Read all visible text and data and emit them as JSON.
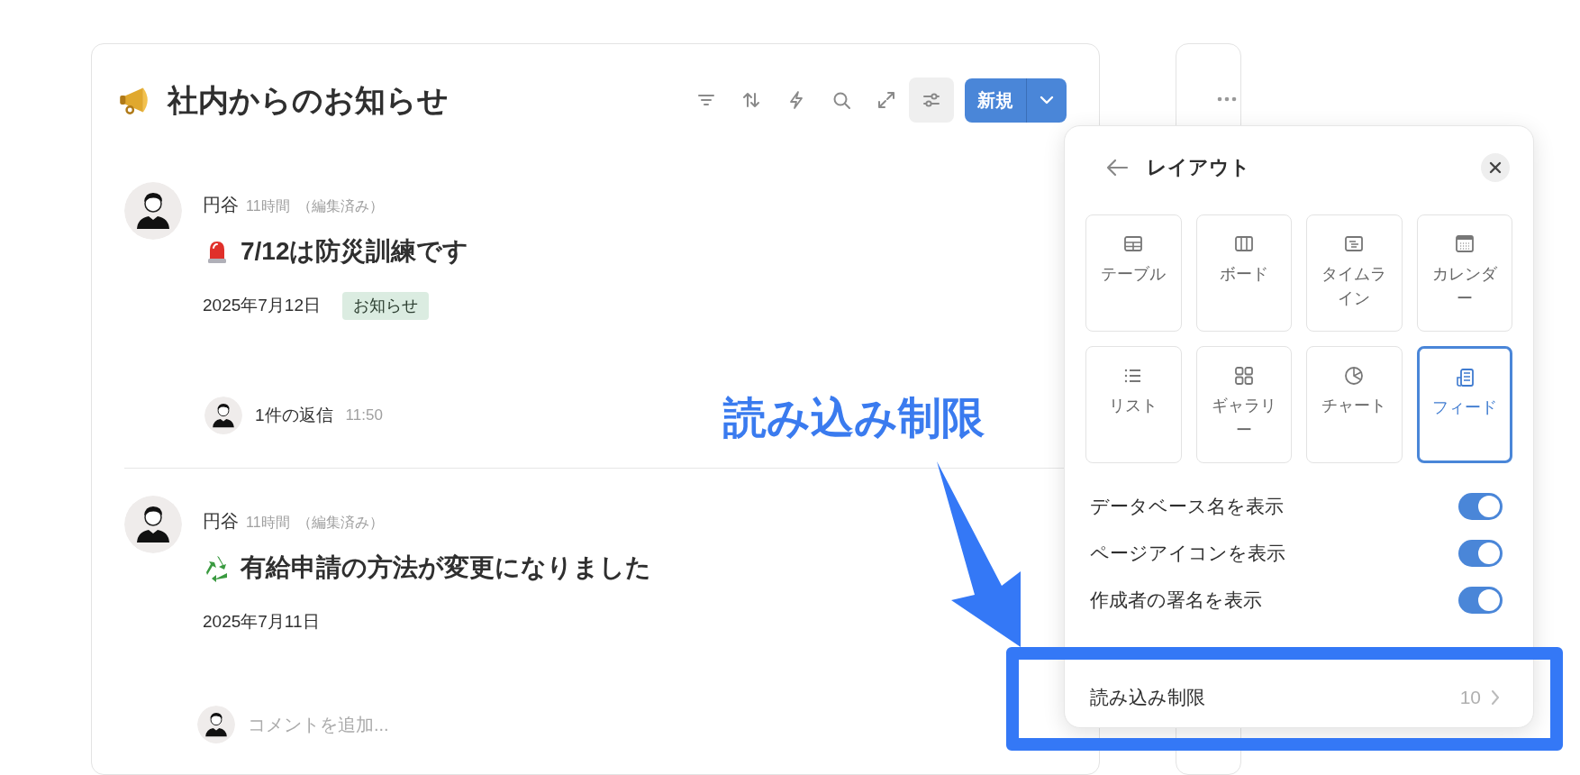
{
  "page": {
    "title": "社内からのお知らせ",
    "new_button": "新規"
  },
  "toolbar": [
    {
      "kind": "filter",
      "selected": false
    },
    {
      "kind": "sort",
      "selected": false
    },
    {
      "kind": "automation",
      "selected": false
    },
    {
      "kind": "search",
      "selected": false
    },
    {
      "kind": "expand",
      "selected": false
    },
    {
      "kind": "settings",
      "selected": true
    }
  ],
  "posts": [
    {
      "author": "円谷",
      "time": "11時間",
      "edited": "（編集済み）",
      "kind": "siren",
      "title": "7/12は防災訓練です",
      "date": "2025年7月12日",
      "tags": [
        {
          "label": "お知らせ"
        }
      ],
      "footer": {
        "kind": "replies",
        "text": "1件の返信",
        "time": "11:50"
      }
    },
    {
      "author": "円谷",
      "time": "11時間",
      "edited": "（編集済み）",
      "kind": "recycle",
      "title": "有給申請の方法が変更になりました",
      "date": "2025年7月11日",
      "footer": {
        "kind": "comment",
        "placeholder": "コメントを追加..."
      }
    }
  ],
  "layout_panel": {
    "title": "レイアウト",
    "layouts": [
      {
        "kind": "table",
        "label": "テーブル",
        "selected": false
      },
      {
        "kind": "board",
        "label": "ボード",
        "selected": false
      },
      {
        "kind": "timeline",
        "label": "タイムライン",
        "selected": false
      },
      {
        "kind": "calendar",
        "label": "カレンダー",
        "selected": false
      },
      {
        "kind": "list",
        "label": "リスト",
        "selected": false
      },
      {
        "kind": "gallery",
        "label": "ギャラリー",
        "selected": false
      },
      {
        "kind": "chart",
        "label": "チャート",
        "selected": false
      },
      {
        "kind": "feed",
        "label": "フィード",
        "selected": true
      }
    ],
    "toggles": [
      {
        "label": "データベース名を表示",
        "on": true
      },
      {
        "label": "ページアイコンを表示",
        "on": true
      },
      {
        "label": "作成者の署名を表示",
        "on": true
      }
    ],
    "options": [
      {
        "label": "読み込み制限",
        "value": "10"
      }
    ]
  },
  "annotation": {
    "label": "読み込み制限"
  }
}
